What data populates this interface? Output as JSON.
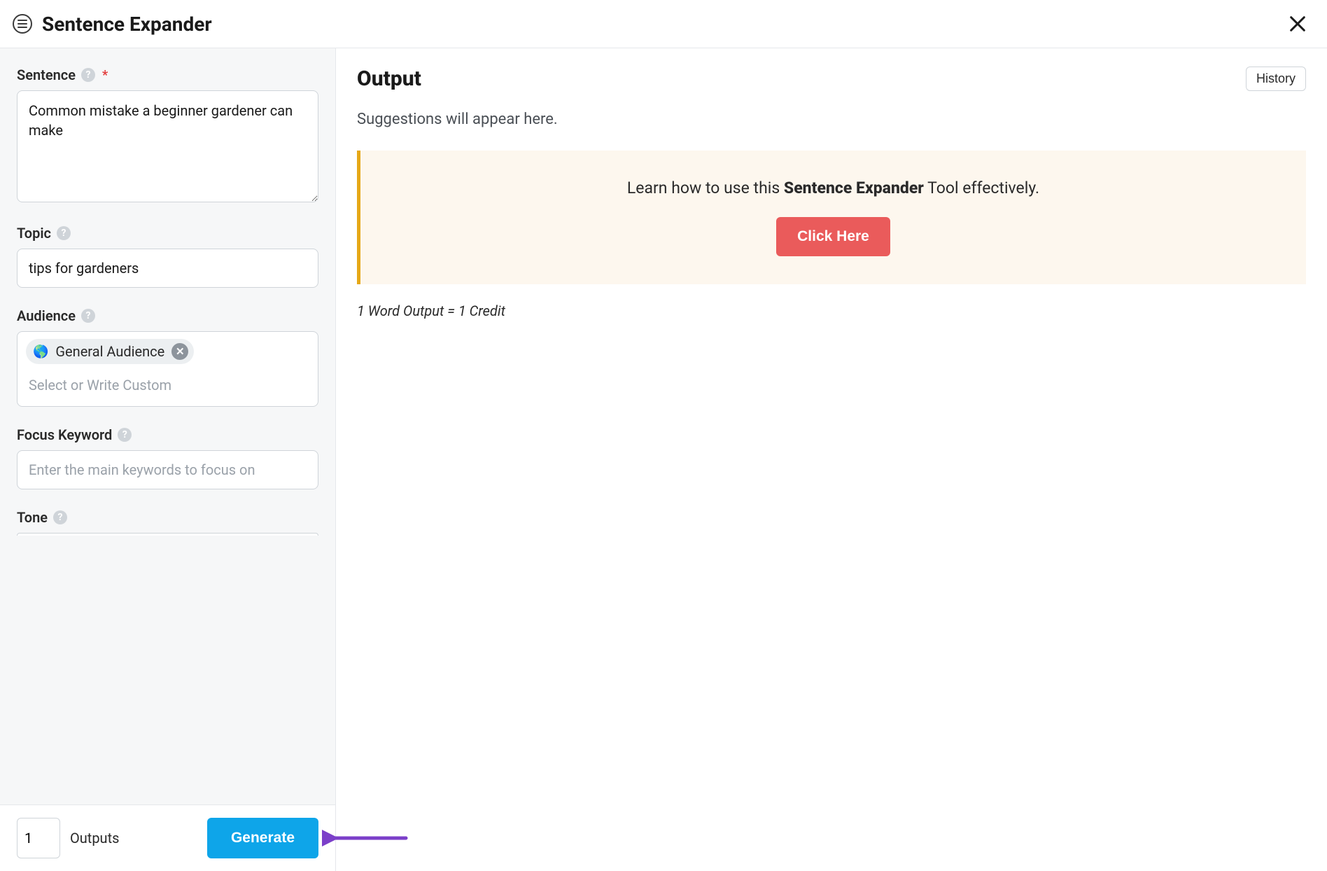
{
  "header": {
    "title": "Sentence Expander"
  },
  "form": {
    "sentence": {
      "label": "Sentence",
      "value": "Common mistake a beginner gardener can make"
    },
    "topic": {
      "label": "Topic",
      "value": "tips for gardeners"
    },
    "audience": {
      "label": "Audience",
      "chip_icon": "🌎",
      "chip_label": "General Audience",
      "placeholder": "Select or Write Custom"
    },
    "focus_keyword": {
      "label": "Focus Keyword",
      "placeholder": "Enter the main keywords to focus on",
      "value": ""
    },
    "tone": {
      "label": "Tone"
    }
  },
  "footer": {
    "outputs_value": "1",
    "outputs_label": "Outputs",
    "generate_label": "Generate"
  },
  "output": {
    "title": "Output",
    "history_label": "History",
    "suggestions_text": "Suggestions will appear here.",
    "callout_prefix": "Learn how to use this ",
    "callout_bold": "Sentence Expander",
    "callout_suffix": " Tool effectively.",
    "callout_button": "Click Here",
    "credit_note": "1 Word Output = 1 Credit"
  }
}
